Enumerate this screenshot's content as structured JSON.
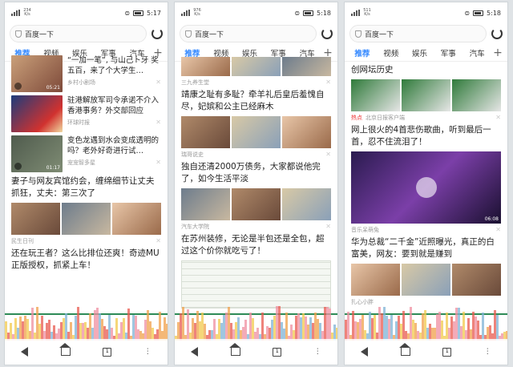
{
  "phones": [
    {
      "status": {
        "time": "5:17",
        "netspeed": "234 K/s"
      },
      "search": {
        "text": "百度一下"
      },
      "tabs": [
        "推荐",
        "视频",
        "娱乐",
        "军事",
        "汽车"
      ],
      "items": [
        {
          "title": "“一加一笔”, 与山己ト牙 奖五百，来了个大学生…",
          "source": "乡村小剧场",
          "duration": "05:21"
        },
        {
          "title": "驻港解放军司令承诺不介入香港事务？外交部回应",
          "source": "环球时报"
        },
        {
          "title": "变色龙遇到水会变成透明的吗？老外好奇进行试…",
          "source": "宠宠智多星",
          "duration": "01:17"
        },
        {
          "title": "妻子与网友宾馆约会，缠绵细节让丈夫抓狂，丈夫：第三次了",
          "source": "民生日刊"
        },
        {
          "title": "还在玩王者？这么比排位还爽！奇迹MU正版授权，抓紧上车！",
          "source": ""
        }
      ]
    },
    {
      "status": {
        "time": "5:18",
        "netspeed": "976 K/s"
      },
      "search": {
        "text": "百度一下"
      },
      "tabs": [
        "推荐",
        "视频",
        "娱乐",
        "军事",
        "汽车"
      ],
      "items": [
        {
          "title": "",
          "source": "三九养生堂"
        },
        {
          "title": "靖康之耻有多耻？牵羊礼后皇后羞愧自尽，妃嫔和公主已经麻木",
          "source": "瑞哥说史"
        },
        {
          "title": "独自还清2000万债务，大家都说他完了，如今生活平淡",
          "source": "汽车大学院"
        },
        {
          "title": "在苏州装修，无论是半包还是全包，超过这个价你就吃亏了！",
          "source": ""
        }
      ]
    },
    {
      "status": {
        "time": "5:18",
        "netspeed": "511 K/s"
      },
      "search": {
        "text": "百度一下"
      },
      "tabs": [
        "推荐",
        "视频",
        "娱乐",
        "军事",
        "汽车"
      ],
      "items": [
        {
          "title": "创网坛历史",
          "source": "北京日报客户端",
          "hot": "热点"
        },
        {
          "title": "网上很火的4首悲伤歌曲，听到最后一首，忍不住流泪了！",
          "source": "音乐呆萌兔",
          "duration": "06:08"
        },
        {
          "title": "华为总裁“二千金”近照曝光，真正的白富美，网友：要到就是赚到",
          "source": "扎心小胖"
        }
      ]
    }
  ],
  "colors": {
    "accent": "#3388ff",
    "hot": "#ee3333",
    "overlay_green": "#2e8b57"
  }
}
